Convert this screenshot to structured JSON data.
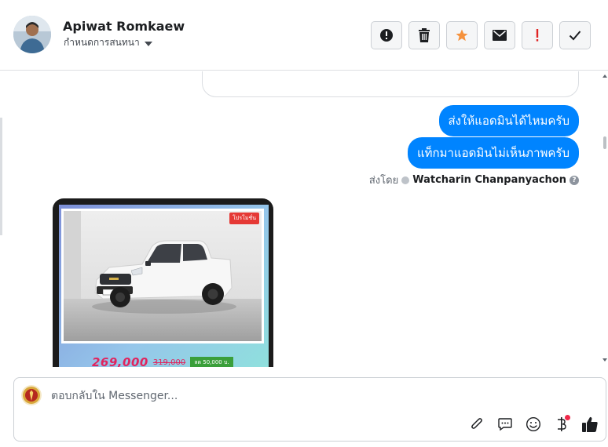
{
  "header": {
    "contact_name": "Apiwat Romkaew",
    "assign_label": "กำหนดการสนทนา"
  },
  "icons": {
    "actions": [
      "exclamation-circle-icon",
      "trash-icon",
      "star-icon",
      "envelope-icon",
      "spam-exclamation-icon",
      "checkmark-icon"
    ],
    "composer": [
      "paperclip-icon",
      "saved-reply-icon",
      "emoji-icon",
      "payment-baht-icon",
      "thumbs-up-icon"
    ]
  },
  "colors": {
    "accent_blue": "#0084ff",
    "star_orange": "#f5923e",
    "spam_red": "#e02424",
    "notification_red": "#f02849"
  },
  "messages": {
    "outgoing": [
      {
        "text": "ส่งให้แอดมินได้ไหมครับ"
      },
      {
        "text": "แท็กมาแอดมินไม่เห็นภาพครับ"
      }
    ],
    "sent_by_prefix": "ส่งโดย",
    "sent_by_name": "Watcharin Chanpanyachon"
  },
  "photo": {
    "badge": "โปรโมชั่น",
    "price_now": "269,000",
    "price_old": "319,000",
    "discount": "ลด 50,000 บ."
  },
  "composer": {
    "placeholder": "ตอบกลับใน Messenger..."
  }
}
